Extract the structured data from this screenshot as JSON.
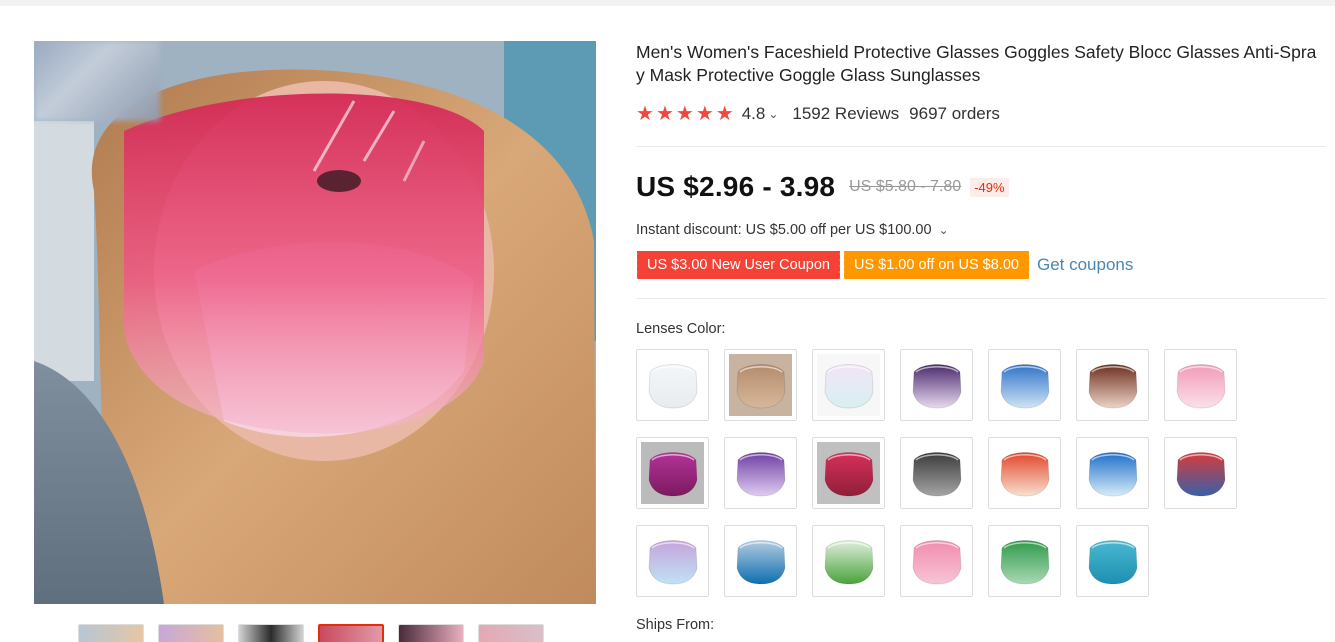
{
  "product": {
    "title": "Men's Women's Faceshield Protective Glasses Goggles Safety Blocc Glasses Anti-Spray Mask Protective Goggle Glass Sunglasses",
    "rating": "4.8",
    "reviews": "1592 Reviews",
    "orders": "9697 orders",
    "price": "US $2.96 - 3.98",
    "old_price": "US $5.80 - 7.80",
    "discount": "-49%",
    "instant_discount": "Instant discount: US $5.00 off per US $100.00",
    "coupons": {
      "new_user": "US $3.00 New User Coupon",
      "off": "US $1.00 off on US $8.00",
      "get_coupons": "Get coupons"
    },
    "lenses_label": "Lenses Color:",
    "ships_label": "Ships From:"
  },
  "colors": {
    "accent_red": "#f44336",
    "accent_orange": "#ff9800",
    "star": "#f0483e",
    "link": "#4a86b4"
  },
  "lens_swatches": [
    {
      "name": "clear",
      "top": "#f4f6f8",
      "bottom": "#e7ecf0",
      "bg": "#ffffff"
    },
    {
      "name": "tan",
      "top": "#b48c6e",
      "bottom": "#d7b79a",
      "bg": "#c8b2a0"
    },
    {
      "name": "iridescent",
      "top": "#f3e4f5",
      "bottom": "#d7f0f2",
      "bg": "#f7f7f7"
    },
    {
      "name": "purple-gradient",
      "top": "#4a2a6c",
      "bottom": "#e8d9f0",
      "bg": "#ffffff"
    },
    {
      "name": "blue-gradient",
      "top": "#2f74c8",
      "bottom": "#cfe3f5",
      "bg": "#ffffff"
    },
    {
      "name": "brown-gradient",
      "top": "#6d2f1f",
      "bottom": "#ecd3c6",
      "bg": "#ffffff"
    },
    {
      "name": "pink",
      "top": "#f29bb8",
      "bottom": "#fbe0ea",
      "bg": "#ffffff"
    },
    {
      "name": "magenta",
      "top": "#b3339a",
      "bottom": "#7c1a5e",
      "bg": "#bbbbbb"
    },
    {
      "name": "violet",
      "top": "#6e3fa3",
      "bottom": "#e0ccf0",
      "bg": "#ffffff"
    },
    {
      "name": "rose",
      "top": "#d8305a",
      "bottom": "#8f1f3a",
      "bg": "#c0c0c0"
    },
    {
      "name": "grey",
      "top": "#3b3b3b",
      "bottom": "#a5a5a5",
      "bg": "#ffffff"
    },
    {
      "name": "orange-gradient",
      "top": "#e2462b",
      "bottom": "#f8e0cf",
      "bg": "#ffffff"
    },
    {
      "name": "sky-gradient",
      "top": "#1f6fc9",
      "bottom": "#d6ecf8",
      "bg": "#ffffff"
    },
    {
      "name": "rainbow",
      "top": "#d63c3a",
      "bottom": "#3a5fa8",
      "bg": "#ffffff"
    },
    {
      "name": "lavender-blue",
      "top": "#c6a3dc",
      "bottom": "#bfe2f5",
      "bg": "#ffffff"
    },
    {
      "name": "ocean",
      "top": "#b3cce0",
      "bottom": "#0d6fb0",
      "bg": "#ffffff"
    },
    {
      "name": "green-gradient",
      "top": "#dfeedd",
      "bottom": "#4aa33b",
      "bg": "#ffffff"
    },
    {
      "name": "pink-solid",
      "top": "#f08dad",
      "bottom": "#f8c4d6",
      "bg": "#ffffff"
    },
    {
      "name": "green",
      "top": "#2f9a4b",
      "bottom": "#a9d9b4",
      "bg": "#ffffff"
    },
    {
      "name": "teal",
      "top": "#4ab8d1",
      "bottom": "#1d8fb0",
      "bg": "#ffffff"
    }
  ]
}
